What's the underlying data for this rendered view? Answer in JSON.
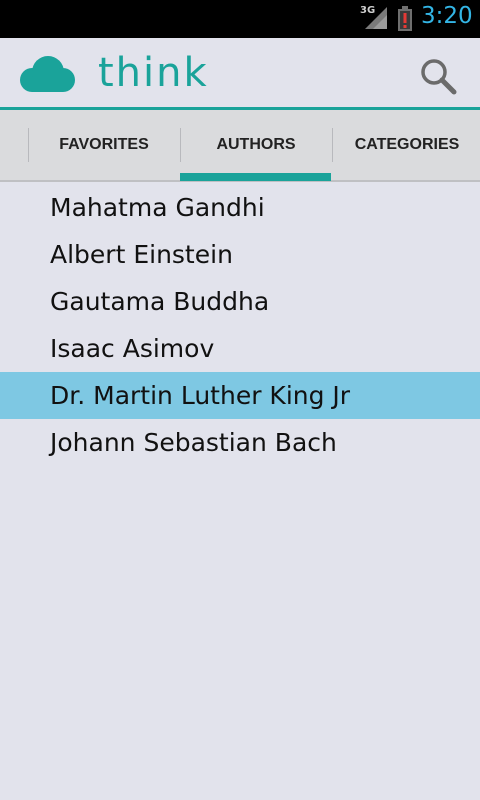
{
  "status_bar": {
    "network": "3G",
    "time": "3:20"
  },
  "action_bar": {
    "app_name": "think"
  },
  "tabs": [
    {
      "label": "FAVORITES"
    },
    {
      "label": "AUTHORS"
    },
    {
      "label": "CATEGORIES"
    }
  ],
  "selected_tab": "AUTHORS",
  "authors": [
    {
      "name": "Mahatma Gandhi"
    },
    {
      "name": "Albert Einstein"
    },
    {
      "name": "Gautama Buddha"
    },
    {
      "name": "Isaac Asimov"
    },
    {
      "name": "Dr. Martin Luther King Jr"
    },
    {
      "name": "Johann Sebastian Bach"
    }
  ],
  "selected_author": "Dr. Martin Luther King Jr",
  "colors": {
    "accent": "#1aa39a",
    "selection": "#7ec8e3",
    "status_time": "#33b5e5",
    "background": "#e2e3ec"
  },
  "icons": {
    "logo": "cloud-icon",
    "search": "search-icon",
    "signal": "signal-icon",
    "battery": "battery-alert-icon"
  }
}
